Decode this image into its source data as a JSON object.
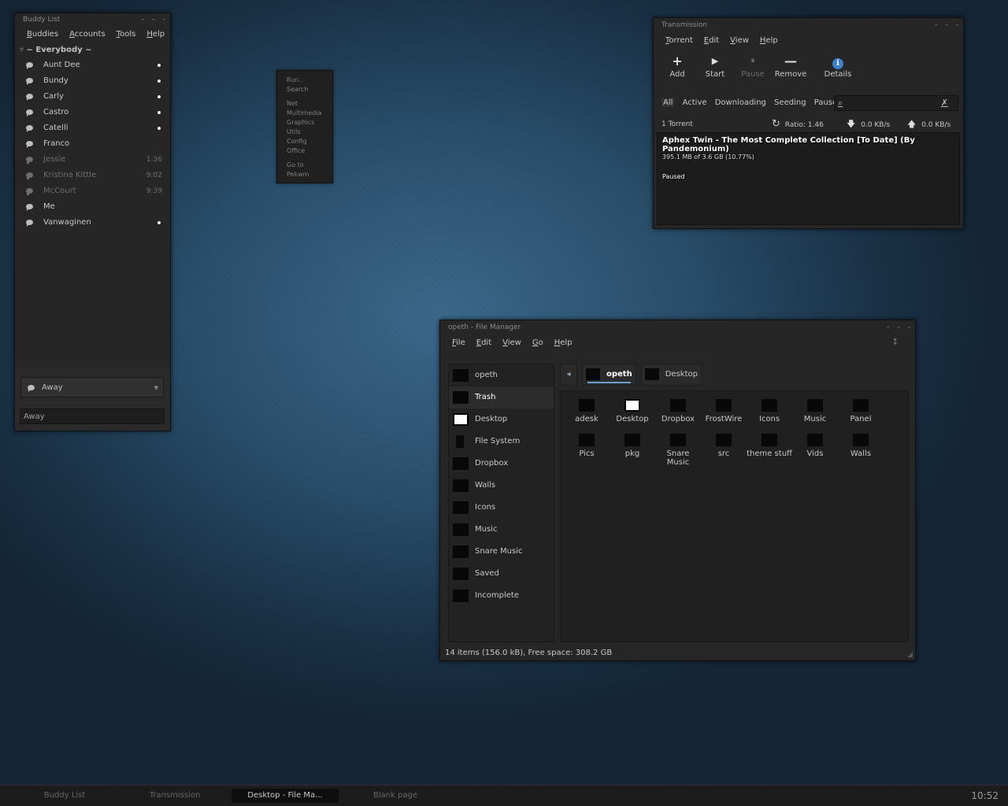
{
  "buddy_list": {
    "title": "Buddy List",
    "window_controls": [
      "-",
      "-",
      "-"
    ],
    "menu": [
      "Buddies",
      "Accounts",
      "Tools",
      "Help"
    ],
    "group": "~ Everybody ~",
    "buddies": [
      {
        "name": "Aunt Dee",
        "status": "•",
        "idle": false
      },
      {
        "name": "Bundy",
        "status": "•",
        "idle": false
      },
      {
        "name": "Carly",
        "status": "•",
        "idle": false
      },
      {
        "name": "Castro",
        "status": "•",
        "idle": false
      },
      {
        "name": "Catelli",
        "status": "•",
        "idle": false
      },
      {
        "name": "Franco",
        "status": "",
        "idle": false
      },
      {
        "name": "Jessie",
        "status": "1:36",
        "idle": true
      },
      {
        "name": "Kristina Kittle",
        "status": "9:02",
        "idle": true
      },
      {
        "name": "McCourt",
        "status": "9:39",
        "idle": true
      },
      {
        "name": "Me",
        "status": "",
        "idle": false
      },
      {
        "name": "Vanwaginen",
        "status": "•",
        "idle": false
      }
    ],
    "status_selector": "Away",
    "status_message": "Away"
  },
  "root_menu": {
    "items": [
      "Run..",
      "Search",
      "",
      "Net",
      "Multimedia",
      "Graphics",
      "Utils",
      "Config",
      "Office",
      "",
      "Go to",
      "Pekwm"
    ]
  },
  "transmission": {
    "title": "Transmission",
    "menu": [
      "Torrent",
      "Edit",
      "View",
      "Help"
    ],
    "toolbar": [
      {
        "label": "Add",
        "icon": "+",
        "enabled": true
      },
      {
        "label": "Start",
        "icon": "▶",
        "enabled": true
      },
      {
        "label": "Pause",
        "icon": "⏸",
        "enabled": false
      },
      {
        "label": "Remove",
        "icon": "—",
        "enabled": true
      },
      {
        "label": "Details",
        "icon": "ℹ",
        "enabled": true
      }
    ],
    "filters": [
      "All",
      "Active",
      "Downloading",
      "Seeding",
      "Paused"
    ],
    "torrent_count": "1 Torrent",
    "ratio": "Ratio: 1.46",
    "down_speed": "0.0 KB/s",
    "up_speed": "0.0 KB/s",
    "torrent": {
      "name": "Aphex Twin - The Most Complete Collection [To Date] (By Pandemonium)",
      "progress_text": "395.1 MB of 3.6 GB (10.77%)",
      "status": "Paused"
    }
  },
  "file_manager": {
    "title": "opeth - File Manager",
    "menu": [
      "File",
      "Edit",
      "View",
      "Go",
      "Help"
    ],
    "sidebar": [
      "opeth",
      "Trash",
      "Desktop",
      "File System",
      "Dropbox",
      "Walls",
      "Icons",
      "Music",
      "Snare Music",
      "Saved",
      "Incomplete"
    ],
    "path": [
      "opeth",
      "Desktop"
    ],
    "files": [
      "adesk",
      "Desktop",
      "Dropbox",
      "FrostWire",
      "Icons",
      "Music",
      "Panel",
      "Pics",
      "pkg",
      "Snare Music",
      "src",
      "theme stuff",
      "Vids",
      "Walls"
    ],
    "statusbar": "14 items (156.0 kB), Free space: 308.2 GB"
  },
  "taskbar": {
    "tasks": [
      "Buddy List",
      "Transmission",
      "Desktop - File Ma...",
      "Blank page"
    ],
    "active_task": "Desktop - File Ma...",
    "clock": "10:52"
  }
}
